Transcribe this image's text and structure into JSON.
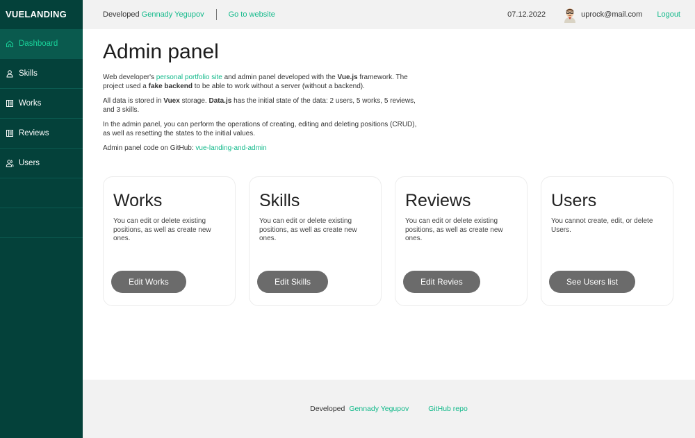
{
  "app": {
    "logo": "VUELANDING"
  },
  "sidebar": {
    "items": [
      {
        "label": "Dashboard",
        "icon": "home-icon",
        "active": true
      },
      {
        "label": "Skills",
        "icon": "user-icon"
      },
      {
        "label": "Works",
        "icon": "list-icon"
      },
      {
        "label": "Reviews",
        "icon": "list-icon"
      },
      {
        "label": "Users",
        "icon": "users-icon"
      }
    ]
  },
  "header": {
    "developed_prefix": "Developed",
    "developer_name": "Gennady Yegupov",
    "website_link": "Go to website",
    "date": "07.12.2022",
    "email": "uprock@mail.com",
    "logout": "Logout"
  },
  "main": {
    "title": "Admin panel",
    "para1": {
      "t1": "Web developer's ",
      "link": "personal portfolio site",
      "t2": " and admin panel developed with the ",
      "bold": "Vue.js",
      "t3": " framework. The project used a ",
      "bold2": "fake backend",
      "t4": " to be able to work without a server (without a backend)."
    },
    "para2": {
      "t1": "All data is stored in ",
      "bold": "Vuex",
      "t2": " storage. ",
      "bold2": "Data.js",
      "t3": " has the initial state of the data: 2 users, 5 works, 5 reviews, and 3 skills."
    },
    "para3": "In the admin panel, you can perform the operations of creating, editing and deleting positions (CRUD), as well as resetting the states to the initial values.",
    "para4": {
      "t1": "Admin panel code on GitHub: ",
      "link": "vue-landing-and-admin"
    },
    "cards": [
      {
        "title": "Works",
        "text": "You can edit or delete existing positions, as well as create new ones.",
        "button": "Edit Works"
      },
      {
        "title": "Skills",
        "text": "You can edit or delete existing positions, as well as create new ones.",
        "button": "Edit Skills"
      },
      {
        "title": "Reviews",
        "text": "You can edit or delete existing positions, as well as create new ones.",
        "button": "Edit Revies"
      },
      {
        "title": "Users",
        "text": "You cannot create, edit, or delete Users.",
        "button": "See Users list"
      }
    ]
  },
  "footer": {
    "developed_prefix": "Developed",
    "developer_name": "Gennady Yegupov",
    "repo_link": "GitHub repo"
  },
  "colors": {
    "sidebar": "#04413a",
    "accent": "#11b98a",
    "button": "#6b6b6b",
    "header_bg": "#f2f2f2"
  }
}
